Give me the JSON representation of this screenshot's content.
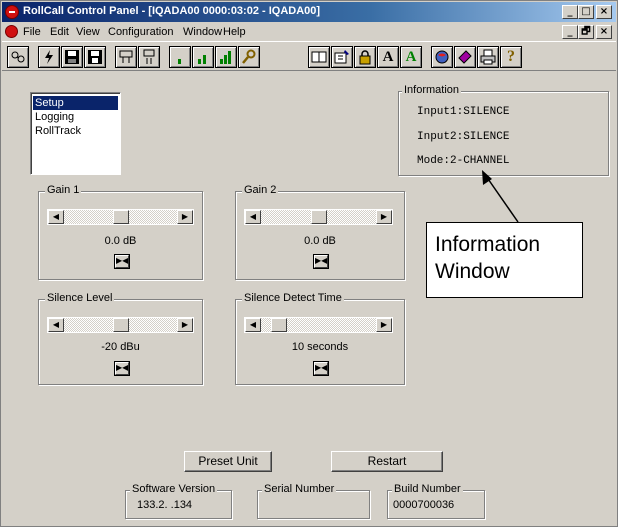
{
  "window": {
    "title": "RollCall Control Panel - [IQADA00 0000:03:02 - IQADA00]",
    "minimize_glyph": "_",
    "restore_glyph": "□",
    "close_glyph": "×"
  },
  "menubar": {
    "items": [
      "File",
      "Edit",
      "View",
      "Configuration",
      "Window",
      "Help"
    ],
    "mdi_minimize_glyph": "_",
    "mdi_restore_glyph": "🗗",
    "mdi_close_glyph": "×"
  },
  "toolbar": {
    "buttons": [
      "network-icon",
      "flash-icon",
      "save-icon",
      "save-all-icon",
      "connect-icon",
      "disconnect-icon",
      "level-low-icon",
      "level-mid-icon",
      "level-high-icon",
      "search-icon",
      "book-icon",
      "edit-icon",
      "lock-icon",
      "font-bold-icon",
      "font-green-icon",
      "globe-icon",
      "tag-icon",
      "print-icon",
      "help-icon"
    ],
    "font_a_label": "A",
    "help_label": "?"
  },
  "nav": {
    "items": [
      {
        "label": "Setup",
        "selected": true
      },
      {
        "label": "Logging",
        "selected": false
      },
      {
        "label": "RollTrack",
        "selected": false
      }
    ]
  },
  "controls": {
    "gain1": {
      "label": "Gain 1",
      "value": "0.0 dB",
      "level": 0.5
    },
    "gain2": {
      "label": "Gain 2",
      "value": "0.0 dB",
      "level": 0.5
    },
    "silence_level": {
      "label": "Silence Level",
      "value": "-20 dBu",
      "level": 0.5
    },
    "silence_detect_time": {
      "label": "Silence Detect Time",
      "value": "10 seconds",
      "level": 0.1
    }
  },
  "slider_arrows": {
    "left": "◀",
    "right": "▶"
  },
  "reset_glyph": "▶◀",
  "information": {
    "label": "Information",
    "lines": [
      "Input1:SILENCE",
      "Input2:SILENCE",
      "Mode:2-CHANNEL"
    ]
  },
  "callout": {
    "line1": "Information",
    "line2": "Window"
  },
  "buttons": {
    "preset_unit": "Preset Unit",
    "restart": "Restart"
  },
  "status": {
    "software_version_label": "Software Version",
    "software_version_value": "133.2. .134",
    "serial_number_label": "Serial Number",
    "serial_number_value": "",
    "build_number_label": "Build Number",
    "build_number_value": "0000700036"
  },
  "colors": {
    "face": "#d4d0c8",
    "title_dark": "#0a246a",
    "title_light": "#a6caf0",
    "selection": "#0a246a",
    "app_icon_red": "#d01010"
  }
}
